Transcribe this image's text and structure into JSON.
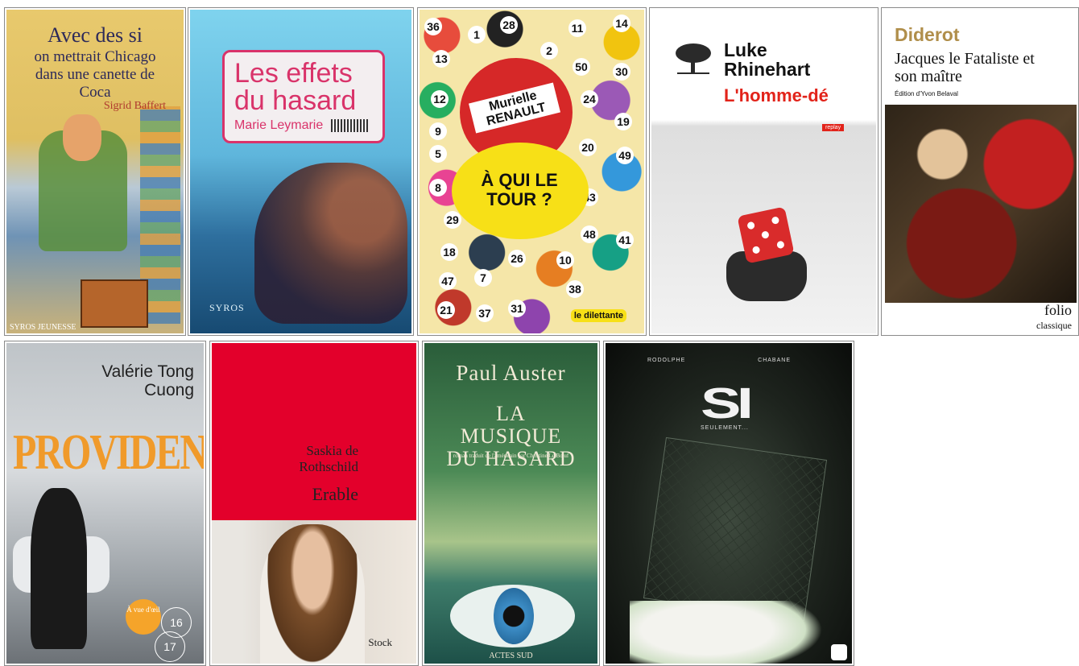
{
  "books": [
    {
      "title": "Avec des si",
      "subtitle": "on mettrait Chicago dans une canette de Coca",
      "author": "Sigrid Baffert",
      "publisher": "SYROS JEUNESSE"
    },
    {
      "title": "Les effets du hasard",
      "author": "Marie Leymarie",
      "publisher": "SYROS"
    },
    {
      "title": "À QUI LE TOUR ?",
      "author": "Murielle RENAULT",
      "publisher": "le dilettante"
    },
    {
      "title": "L'homme-dé",
      "author": "Luke Rhinehart",
      "badge": "replay"
    },
    {
      "title": "Jacques le Fataliste et son maître",
      "author": "Diderot",
      "edition": "Édition d'Yvon Belaval",
      "series": "folio",
      "series_sub": "classique"
    },
    {
      "title": "PROVIDENCE",
      "author": "Valérie Tong Cuong",
      "badge": "À vue d'œil",
      "numbers": [
        "16",
        "17"
      ]
    },
    {
      "title": "Erable",
      "author": "Saskia de Rothschild",
      "publisher": "Stock"
    },
    {
      "title": "LA MUSIQUE DU HASARD",
      "author": "Paul Auster",
      "translation": "roman traduit de l'américain par Christine Le Bœuf",
      "publisher": "ACTES SUD"
    },
    {
      "title": "SI",
      "subtitle": "SEULEMENT...",
      "author1": "RODOLPHE",
      "author2": "CHABANE"
    }
  ],
  "balls": [
    "36",
    "1",
    "28",
    "2",
    "11",
    "14",
    "13",
    "50",
    "30",
    "12",
    "24",
    "19",
    "9",
    "20",
    "49",
    "5",
    "8",
    "43",
    "29",
    "48",
    "41",
    "18",
    "26",
    "10",
    "47",
    "7",
    "38",
    "21",
    "37",
    "31"
  ]
}
